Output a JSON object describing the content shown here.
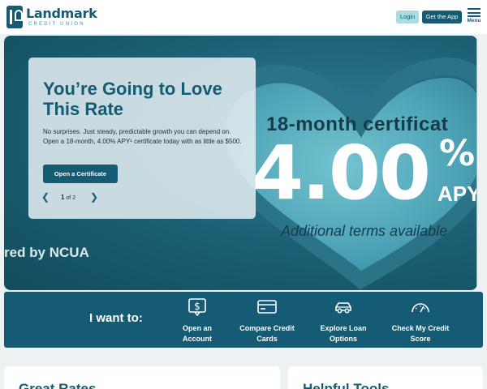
{
  "header": {
    "logo_name": "Landmark",
    "logo_subtitle": "CREDIT UNION",
    "login_label": "Login",
    "get_app_label": "Get the App",
    "menu_label": "Menu"
  },
  "hero": {
    "heading": "18-month certificat",
    "rate": "4.00",
    "percent_sign": "%",
    "apy": "APY",
    "terms": "Additional terms available",
    "ncua": "red by NCUA"
  },
  "promo": {
    "title": "You’re Going to Love This Rate",
    "body": "No surprises. Just steady, predictable growth you can depend on. Open a 18-month, 4.00% APY¹ certificate today with as little as $500.",
    "cta_label": "Open a Certificate",
    "pager_current": "1",
    "pager_suffix": "of 2",
    "prev_icon": "chevron-left-icon",
    "next_icon": "chevron-right-icon"
  },
  "quick_links": {
    "title": "I want to:",
    "items": [
      {
        "label": "Open an Account",
        "icon": "dollar-sign-icon"
      },
      {
        "label": "Compare Credit Cards",
        "icon": "credit-card-icon"
      },
      {
        "label": "Explore Loan Options",
        "icon": "car-icon"
      },
      {
        "label": "Check My Credit Score",
        "icon": "gauge-icon"
      }
    ]
  },
  "cards": {
    "left_title": "Great Rates",
    "right_title": "Helpful Tools"
  },
  "colors": {
    "brand": "#155b73",
    "accent_light": "#a8dbe3",
    "hero_bg": "#1b5d72"
  }
}
